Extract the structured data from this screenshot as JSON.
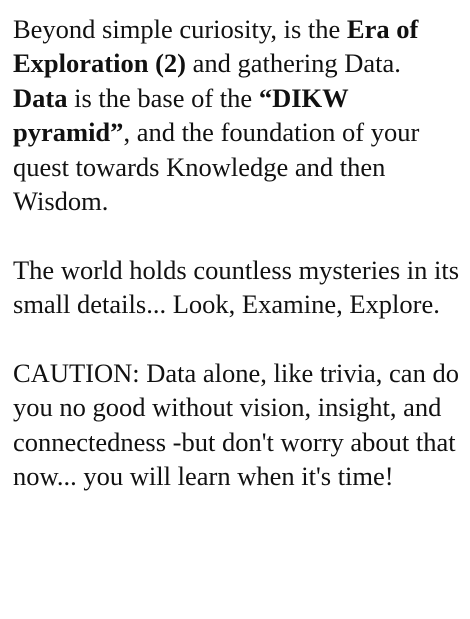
{
  "paragraphs": {
    "p1": {
      "t1": "Beyond simple curiosity, is the ",
      "b1": "Era of Exploration (2)",
      "t2": " and gathering Data. ",
      "b2": "Data",
      "t3": " is the base of the ",
      "b3": "“DIKW pyramid”",
      "t4": ", and the foundation of your quest towards Knowledge and then Wisdom."
    },
    "p2": {
      "t1": "The world holds countless mysteries in its small details... Look, Examine, Explore."
    },
    "p3": {
      "t1": "CAUTION: Data alone, like trivia, can do you no good without vision, insight, and connectedness -but don't worry about that now... you will learn when it's time!"
    }
  }
}
